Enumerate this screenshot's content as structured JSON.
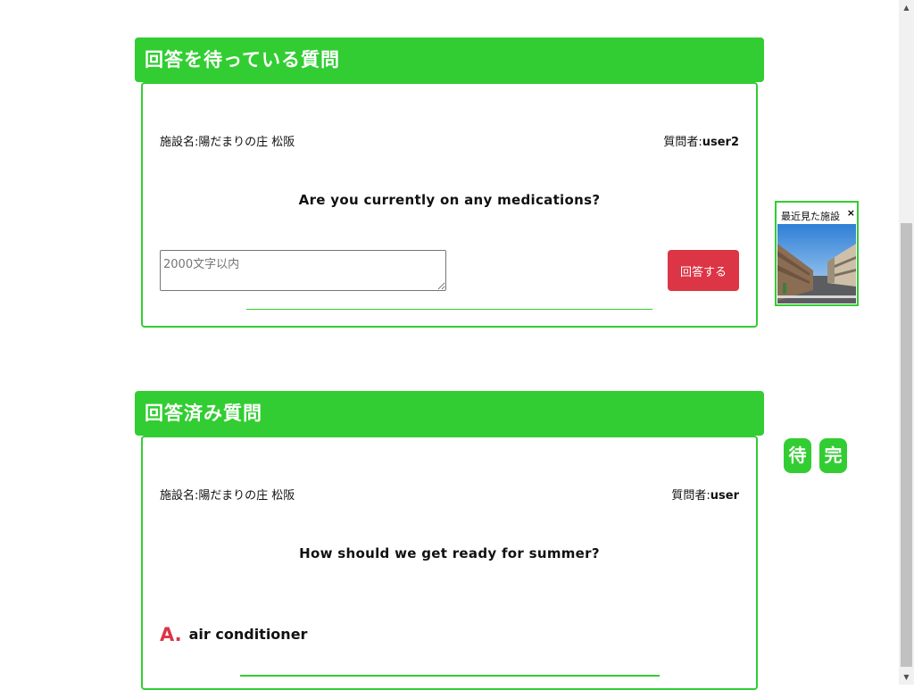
{
  "sections": {
    "waiting": {
      "title": "回答を待っている質問",
      "facility": "施設名:陽だまりの庄 松阪",
      "questioner_label": "質問者:",
      "questioner_user": "user2",
      "question": "Are you currently on any medications?",
      "answer_placeholder": "2000文字以内",
      "answer_button": "回答する"
    },
    "answered": {
      "title": "回答済み質問",
      "facility": "施設名:陽だまりの庄 松阪",
      "questioner_label": "質問者:",
      "questioner_user": "user",
      "question": "How should we get ready for summer?",
      "answer_mark": "A.",
      "answer_text": "air conditioner"
    }
  },
  "recent": {
    "title": "最近見た施設",
    "close": "×"
  },
  "jump": {
    "waiting": "待",
    "done": "完"
  },
  "colors": {
    "accent": "#32cd32",
    "danger": "#dc3545"
  }
}
